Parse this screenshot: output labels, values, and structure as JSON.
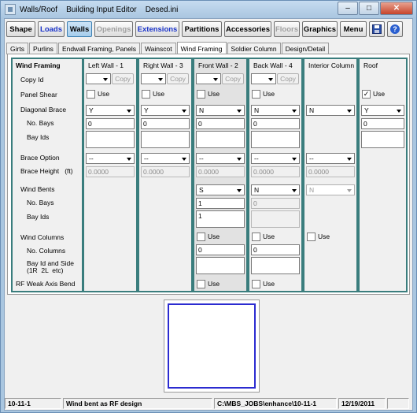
{
  "window": {
    "icon": "app-icon",
    "title": "Walls/Roof    Building Input Editor    Desed.ini",
    "controls": {
      "minimize": "–",
      "maximize": "□",
      "close": "✕"
    }
  },
  "toolbar": {
    "buttons": [
      "Shape",
      "Loads",
      "Walls",
      "Openings",
      "Extensions",
      "Partitions",
      "Accessories",
      "Floors",
      "Graphics",
      "Menu"
    ],
    "save_icon": "floppy-disk-icon",
    "help_icon": "help-icon",
    "help_label": "?"
  },
  "tabs": [
    "Girts",
    "Purlins",
    "Endwall Framing, Panels",
    "Wainscot",
    "Wind Framing",
    "Soldier Column",
    "Design/Detail"
  ],
  "labels": {
    "heading": "Wind Framing",
    "copy_id": "Copy Id",
    "panel_shear": "Panel Shear",
    "diagonal_brace": "Diagonal Brace",
    "no_bays": "No. Bays",
    "bay_ids": "Bay Ids",
    "brace_option": "Brace Option",
    "brace_height": "Brace Height   (ft)",
    "wind_bents": "Wind Bents",
    "wb_no_bays": "No. Bays",
    "wb_bay_ids": "Bay Ids",
    "wind_columns": "Wind Columns",
    "no_columns": "No. Columns",
    "bay_id_side": "Bay Id and Side",
    "bay_id_side2": "(1R  2L  etc)",
    "rf_weak": "RF Weak Axis Bend"
  },
  "columns": {
    "left": {
      "header": "Left Wall - 1",
      "copy": "Copy",
      "use": "Use",
      "diag": "Y",
      "bays": "0",
      "brace_opt": "--",
      "brace_h": "0.0000"
    },
    "right": {
      "header": "Right Wall - 3",
      "copy": "Copy",
      "use": "Use",
      "diag": "Y",
      "bays": "0",
      "brace_opt": "--",
      "brace_h": "0.0000"
    },
    "front": {
      "header": "Front Wall - 2",
      "copy": "Copy",
      "use": "Use",
      "diag": "N",
      "bays": "0",
      "brace_opt": "--",
      "brace_h": "0.0000",
      "wb": "S",
      "wb_bays": "1",
      "wb_ids": "1",
      "wc_use": "Use",
      "wc_cols": "0",
      "rf_use": "Use"
    },
    "back": {
      "header": "Back Wall - 4",
      "copy": "Copy",
      "use": "Use",
      "diag": "N",
      "bays": "0",
      "brace_opt": "--",
      "brace_h": "0.0000",
      "wb": "N",
      "wb_bays": "0",
      "wc_use": "Use",
      "wc_cols": "0",
      "rf_use": "Use"
    },
    "interior": {
      "header": "Interior Column",
      "diag": "N",
      "brace_opt": "--",
      "brace_h": "0.0000",
      "wb": "N",
      "wc_use": "Use"
    },
    "roof": {
      "header": "Roof",
      "use": "Use",
      "check": "✓",
      "diag": "Y",
      "bays": "0"
    }
  },
  "status": {
    "job": "10-11-1",
    "message": "Wind bent as RF design",
    "path": "C:\\MBS_JOBS\\enhance\\10-11-1",
    "date": "12/19/2011"
  }
}
